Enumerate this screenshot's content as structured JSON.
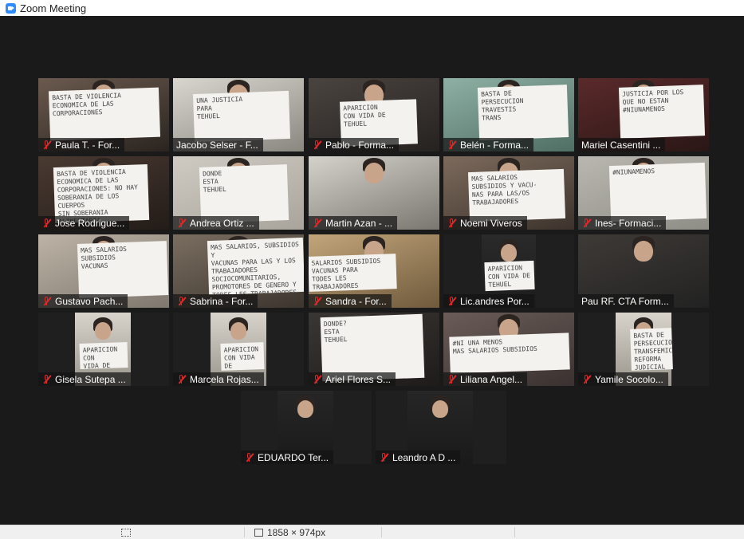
{
  "window": {
    "title": "Zoom Meeting",
    "app_icon": "zoom-icon"
  },
  "colors": {
    "background": "#1a1a1a",
    "speaking_border": "#c9e64b",
    "muted_mic": "#e02828"
  },
  "participants": [
    {
      "name": "Paula T. - For...",
      "muted": true,
      "sign": "BASTA DE VIOLENCIA\nECONOMICA DE LAS\nCORPORACIONES"
    },
    {
      "name": "Jacobo Selser - F...",
      "muted": false,
      "speaking": true,
      "sign": "UNA JUSTICIA\nPARA\nTEHUEL"
    },
    {
      "name": "Pablo - Forma...",
      "muted": true,
      "sign": "APARICION\nCON VIDA DE\nTEHUEL"
    },
    {
      "name": "Belén - Forma...",
      "muted": true,
      "sign": "BASTA DE\nPERSECUCION\nTRAVESTIS\nTRANS"
    },
    {
      "name": "Mariel Casentini ...",
      "muted": false,
      "sign": "JUSTICIA POR LOS\nQUE NO ESTAN\n#NIUNAMENOS"
    },
    {
      "name": "Jose Rodrigue...",
      "muted": true,
      "sign": "BASTA DE VIOLENCIA\nECONOMICA DE LAS\nCORPORACIONES: NO HAY\nSOBERANIA DE LOS CUERPOS\nSIN SOBERANIA ALIMENTARIA"
    },
    {
      "name": "Andrea Ortiz ...",
      "muted": true,
      "sign": "DONDE\nESTA\nTEHUEL"
    },
    {
      "name": "Martin Azan - ...",
      "muted": true,
      "sign": ""
    },
    {
      "name": "Noemi Viveros",
      "muted": true,
      "sign": "MAS SALARIOS\nSUBSIDIOS Y VACU-\nNAS PARA LAS/OS\nTRABAJADORES"
    },
    {
      "name": "Ines- Formaci...",
      "muted": true,
      "sign": "#NIUNAMENOS"
    },
    {
      "name": "Gustavo Pach...",
      "muted": true,
      "sign": "MAS SALARIOS\nSUBSIDIOS\nVACUNAS"
    },
    {
      "name": "Sabrina - For...",
      "muted": true,
      "sign": "MAS SALARIOS, SUBSIDIOS Y\nVACUNAS PARA LAS Y LOS\nTRABAJADORES\nSOCIOCOMUNITARIOS,\nPROMOTORES DE GENERO Y\nTODES LES TRABAJADORES\nESENCIALES\n#NIUNAMENOS"
    },
    {
      "name": "Sandra - For...",
      "muted": true,
      "sign": "SALARIOS SUBSIDIOS\nVACUNAS PARA\nTODES LES TRABAJADORES"
    },
    {
      "name": "Lic.andres Por...",
      "muted": true,
      "sign": "APARICION\nCON VIDA DE\nTEHUEL"
    },
    {
      "name": "Pau RF. CTA Form...",
      "muted": false,
      "sign": ""
    },
    {
      "name": "Gisela Sutepa ...",
      "muted": true,
      "sign": "APARICION CON\nVIDA DE\nTEHUEL"
    },
    {
      "name": "Marcela Rojas...",
      "muted": true,
      "sign": "APARICION\nCON VIDA DE\nTEHUEL"
    },
    {
      "name": "Ariel Flores S...",
      "muted": true,
      "sign": "DONDE?\nESTA\nTEHUEL"
    },
    {
      "name": "Liliana Angel...",
      "muted": true,
      "sign": "#NI UNA MENOS\nMAS SALARIOS SUBSIDIOS"
    },
    {
      "name": "Yamile Socolo...",
      "muted": true,
      "sign": "BASTA DE PERSECUCION\nTRANSFEMICIDIOS\nREFORMA\nJUDICIAL"
    },
    {
      "name": "EDUARDO Ter...",
      "muted": true,
      "sign": ""
    },
    {
      "name": "Leandro A D ...",
      "muted": true,
      "sign": ""
    }
  ],
  "statusbar": {
    "crop_icon": "crop-icon",
    "dims_icon": "resize-icon",
    "dimensions": "1858 × 974px"
  }
}
